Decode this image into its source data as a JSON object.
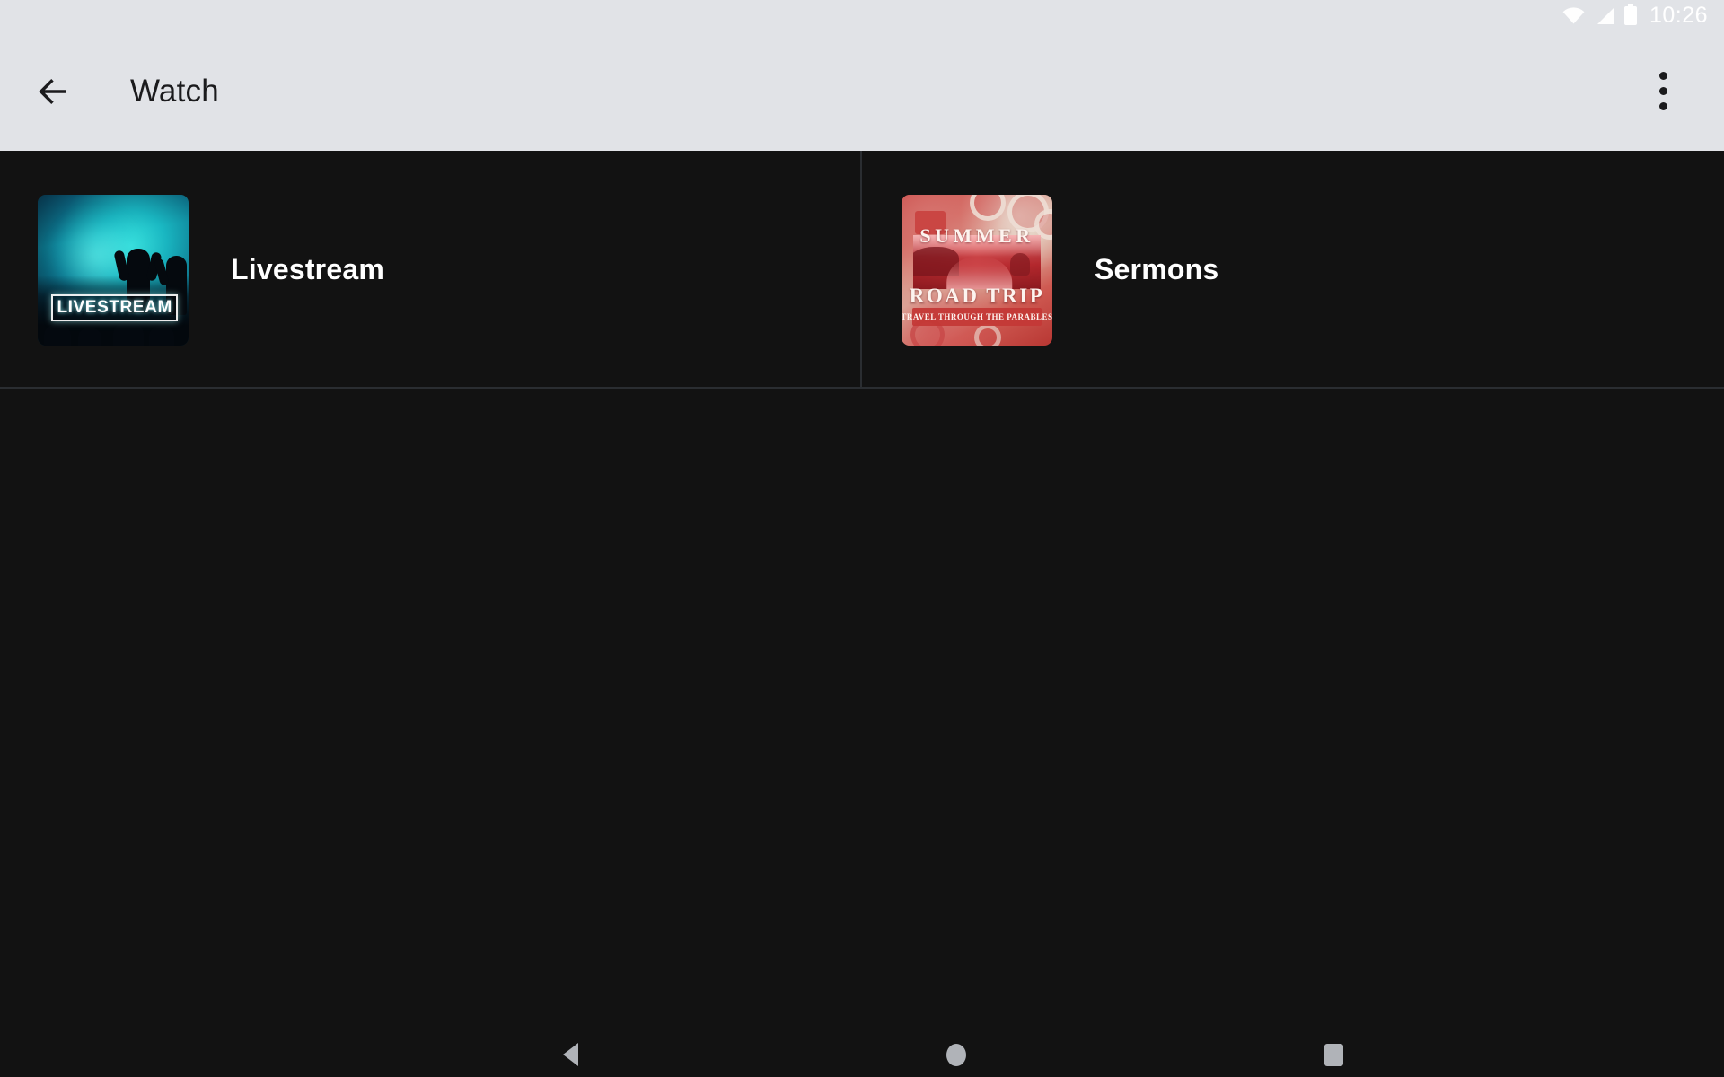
{
  "status_bar": {
    "time": "10:26",
    "icons": [
      "wifi-icon",
      "cell-signal-icon",
      "battery-icon"
    ],
    "background_color": "#E1E3E7",
    "foreground_color": "#FFFFFF"
  },
  "app_bar": {
    "back_label": "back-arrow-icon",
    "title": "Watch",
    "overflow_label": "overflow-menu-icon",
    "background_color": "#E1E3E7",
    "title_color": "#1B1B1D"
  },
  "content": {
    "background_color": "#121212",
    "divider_color": "#2A2D31",
    "items": [
      {
        "title": "Livestream",
        "thumbnail": {
          "name": "livestream-thumbnail",
          "overlay_text": "LIVESTREAM",
          "accent_color": "#12A8B4",
          "description_colors": [
            "#12A8B4",
            "#3CE6E1",
            "#061824"
          ]
        }
      },
      {
        "title": "Sermons",
        "thumbnail": {
          "name": "sermons-thumbnail",
          "line1": "SUMMER",
          "line2": "ROAD TRIP",
          "banner_text": "TRAVEL THROUGH THE PARABLES",
          "accent_color": "#C9413F",
          "description_colors": [
            "#C9413F",
            "#DFC4B2",
            "#B83733"
          ]
        }
      }
    ]
  },
  "nav_bar": {
    "background_color": "#121212",
    "icon_color": "#B0B3B8",
    "buttons": [
      {
        "name": "nav-back",
        "label": "back-triangle-icon"
      },
      {
        "name": "nav-home",
        "label": "home-circle-icon"
      },
      {
        "name": "nav-recents",
        "label": "recents-square-icon"
      }
    ]
  }
}
